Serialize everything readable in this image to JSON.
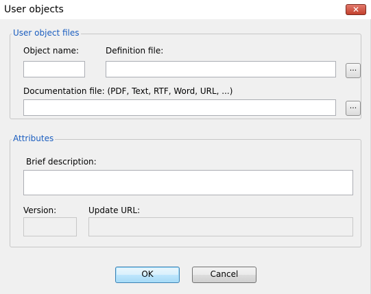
{
  "window": {
    "title": "User objects",
    "close_label": "✕"
  },
  "files_group": {
    "legend": "User object files",
    "object_name_label": "Object name:",
    "object_name_value": "",
    "definition_file_label": "Definition file:",
    "definition_file_value": "",
    "browse_label": "...",
    "documentation_file_label": "Documentation file:  (PDF, Text, RTF, Word, URL, ...)",
    "documentation_file_value": ""
  },
  "attributes_group": {
    "legend": "Attributes",
    "brief_description_label": "Brief description:",
    "brief_description_value": "",
    "version_label": "Version:",
    "version_value": "",
    "update_url_label": "Update URL:",
    "update_url_value": ""
  },
  "buttons": {
    "ok": "OK",
    "cancel": "Cancel"
  }
}
